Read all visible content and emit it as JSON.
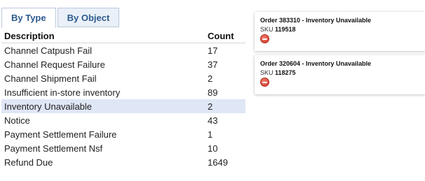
{
  "tabs": [
    {
      "label": "By Type",
      "active": true
    },
    {
      "label": "By Object",
      "active": false
    }
  ],
  "table": {
    "headers": {
      "description": "Description",
      "count": "Count"
    },
    "rows": [
      {
        "description": "Channel Catpush Fail",
        "count": "17"
      },
      {
        "description": "Channel Request Failure",
        "count": "37"
      },
      {
        "description": "Channel Shipment Fail",
        "count": "2"
      },
      {
        "description": "Insufficient in-store inventory",
        "count": "89"
      },
      {
        "description": "Inventory Unavailable",
        "count": "2",
        "selected": true
      },
      {
        "description": "Notice",
        "count": "43"
      },
      {
        "description": "Payment Settlement Failure",
        "count": "1"
      },
      {
        "description": "Payment Settlement Nsf",
        "count": "10"
      },
      {
        "description": "Refund Due",
        "count": "1649"
      }
    ]
  },
  "cards": [
    {
      "title": "Order 383310 - Inventory Unavailable",
      "sku_label": "SKU",
      "sku": "119518",
      "action_icon": "remove-icon"
    },
    {
      "title": "Order 320604 - Inventory Unavailable",
      "sku_label": "SKU",
      "sku": "118275",
      "action_icon": "remove-icon"
    }
  ],
  "colors": {
    "tab_text": "#2d5a8e",
    "selected_row": "#dfe6f5",
    "remove_red": "#d23b2a"
  }
}
